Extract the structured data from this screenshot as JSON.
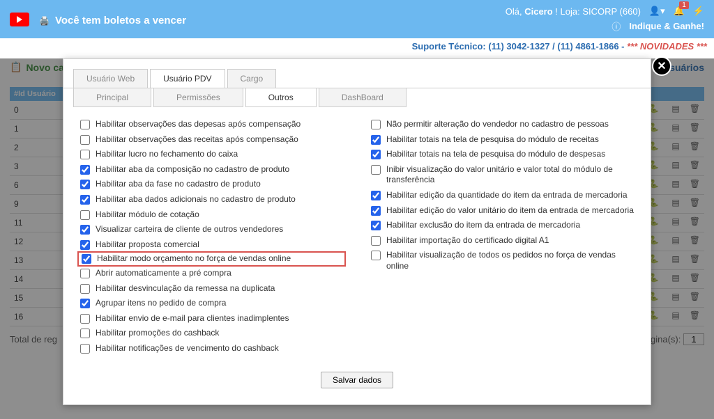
{
  "header": {
    "title": "Você tem boletos a vencer",
    "greeting_prefix": "Olá, ",
    "greeting_name": "Cicero",
    "greeting_suffix": " ! Loja: SICORP (660)",
    "notif_count": "1",
    "share": "Indique & Ganhe!"
  },
  "support": {
    "label": "Suporte Técnico: (11) 3042-1327 / (11) 4861-1866 - ",
    "nov": "*** NOVIDADES ***"
  },
  "page": {
    "title_left": "Novo ca",
    "title_right": "e usuários"
  },
  "table": {
    "header_id": "#Id Usuário",
    "rows": [
      "0",
      "1",
      "2",
      "3",
      "6",
      "9",
      "11",
      "12",
      "13",
      "14",
      "15",
      "16"
    ]
  },
  "footer": {
    "left": "Total de reg",
    "right_label": "gina(s):",
    "page": "1"
  },
  "modal": {
    "tabs_top": [
      "Usuário Web",
      "Usuário PDV",
      "Cargo"
    ],
    "tabs_top_active": 1,
    "tabs_sub": [
      "Principal",
      "Permissões",
      "Outros",
      "DashBoard"
    ],
    "tabs_sub_active": 2,
    "save": "Salvar dados",
    "left": [
      {
        "c": false,
        "t": "Habilitar observações das depesas após compensação"
      },
      {
        "c": false,
        "t": "Habilitar observações das receitas após compensação"
      },
      {
        "c": false,
        "t": "Habilitar lucro no fechamento do caixa"
      },
      {
        "c": true,
        "t": "Habilitar aba da composição no cadastro de produto"
      },
      {
        "c": true,
        "t": "Habilitar aba da fase no cadastro de produto"
      },
      {
        "c": true,
        "t": "Habilitar aba dados adicionais no cadastro de produto"
      },
      {
        "c": false,
        "t": "Habilitar módulo de cotação"
      },
      {
        "c": true,
        "t": "Visualizar carteira de cliente de outros vendedores"
      },
      {
        "c": true,
        "t": "Habilitar proposta comercial"
      },
      {
        "c": true,
        "t": "Habilitar modo orçamento no força de vendas online",
        "hl": true
      },
      {
        "c": false,
        "t": "Abrir automaticamente a pré compra"
      },
      {
        "c": false,
        "t": "Habilitar desvinculação da remessa na duplicata"
      },
      {
        "c": true,
        "t": "Agrupar itens no pedido de compra"
      },
      {
        "c": false,
        "t": "Habilitar envio de e-mail para clientes inadimplentes"
      },
      {
        "c": false,
        "t": "Habilitar promoções do cashback"
      },
      {
        "c": false,
        "t": "Habilitar notificações de vencimento do cashback"
      }
    ],
    "right": [
      {
        "c": false,
        "t": "Não permitir alteração do vendedor no cadastro de pessoas"
      },
      {
        "c": true,
        "t": "Habilitar totais na tela de pesquisa do módulo de receitas"
      },
      {
        "c": true,
        "t": "Habilitar totais na tela de pesquisa do módulo de despesas"
      },
      {
        "c": false,
        "t": "Inibir visualização do valor unitário e valor total do módulo de transferência"
      },
      {
        "c": true,
        "t": "Habilitar edição da quantidade do item da entrada de mercadoria"
      },
      {
        "c": true,
        "t": "Habilitar edição do valor unitário do item da entrada de mercadoria"
      },
      {
        "c": true,
        "t": "Habilitar exclusão do item da entrada de mercadoria"
      },
      {
        "c": false,
        "t": "Habilitar importação do certificado digital A1"
      },
      {
        "c": false,
        "t": "Habilitar visualização de todos os pedidos no força de vendas online"
      }
    ]
  }
}
